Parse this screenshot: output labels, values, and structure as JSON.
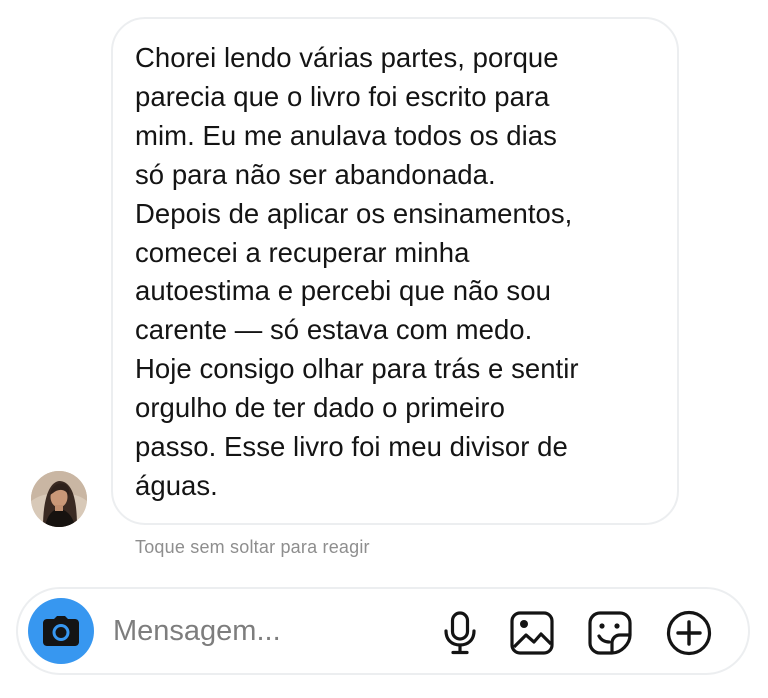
{
  "message": {
    "text": "Chorei lendo várias partes, porque\nparecia que o livro foi escrito para\nmim. Eu me anulava todos os dias\nsó para não ser abandonada.\nDepois de aplicar os ensinamentos,\ncomecei a recuperar minha\nautoestima e percebi que não sou\ncarente — só estava com medo.\nHoje consigo olhar para trás e sentir\norgulho de ter dado o primeiro\npasso. Esse livro foi meu divisor de\náguas.",
    "hint": "Toque sem soltar para reagir"
  },
  "composer": {
    "placeholder": "Mensagem...",
    "accent_color": "#3797f0",
    "icons": [
      "camera-icon",
      "microphone-icon",
      "gallery-icon",
      "sticker-icon",
      "add-icon"
    ]
  }
}
